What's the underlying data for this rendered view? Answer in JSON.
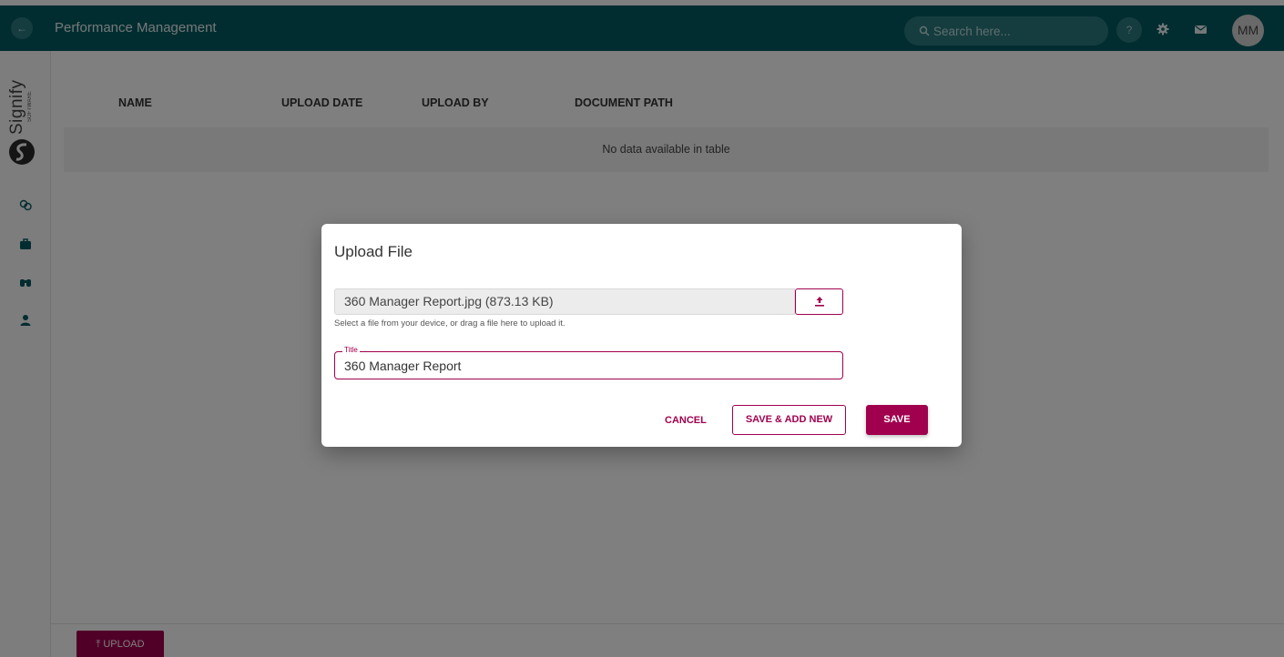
{
  "header": {
    "back_label": "←",
    "app_title": "Performance Management",
    "search_placeholder": "Search here...",
    "help_label": "?",
    "avatar_initials": "MM"
  },
  "sidebar": {
    "logo_text": "Signify",
    "logo_subtext": "SOFTWARE",
    "items": [
      {
        "icon": "people-icon"
      },
      {
        "icon": "briefcase-icon"
      },
      {
        "icon": "binoculars-icon"
      },
      {
        "icon": "user-icon"
      }
    ]
  },
  "table": {
    "columns": [
      "NAME",
      "UPLOAD DATE",
      "UPLOAD BY",
      "DOCUMENT PATH"
    ],
    "empty_text": "No data available in table"
  },
  "footer": {
    "upload_label": "UPLOAD"
  },
  "dialog": {
    "title": "Upload File",
    "file_value": "360 Manager Report.jpg (873.13 KB)",
    "hint": "Select a file from your device, or drag a file here to upload it.",
    "title_label": "Title",
    "title_value": "360 Manager Report",
    "cancel_label": "CANCEL",
    "save_add_label": "SAVE & ADD NEW",
    "save_label": "SAVE"
  },
  "colors": {
    "topbar": "#045a61",
    "accent": "#a0004e",
    "teal_icon": "#045a61"
  }
}
